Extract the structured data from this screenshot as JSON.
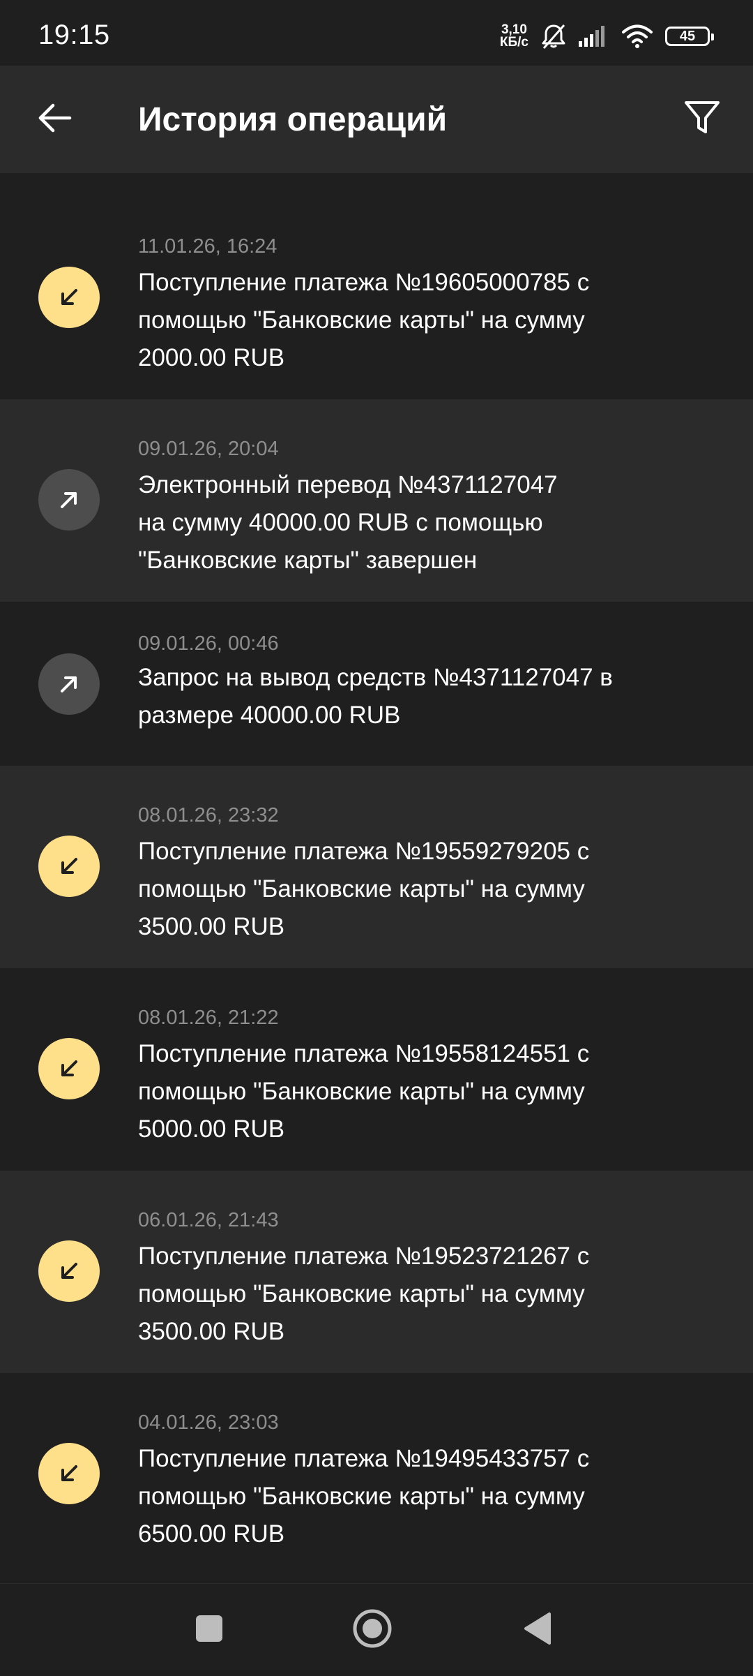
{
  "status_bar": {
    "time": "19:15",
    "net_speed_value": "3,10",
    "net_speed_unit": "КБ/с",
    "battery": "45",
    "icons": [
      "mute-bell-icon",
      "signal-icon",
      "wifi-icon",
      "battery-icon"
    ]
  },
  "app_bar": {
    "title": "История операций",
    "icons": [
      "arrow-left-icon",
      "filter-icon"
    ]
  },
  "colors": {
    "background": "#1f1f1f",
    "row_alt": "#2b2b2b",
    "incoming_icon_bg": "#ffe08a",
    "outgoing_icon_bg": "#4d4d4d",
    "date_text": "#8e8e8e"
  },
  "operations": [
    {
      "type": "incoming",
      "icon": "arrow-down-left-icon",
      "date": "11.01.26, 16:24",
      "text": "Поступление платежа №19605000785 с\nпомощью \"Банковские карты\" на сумму\n2000.00 RUB"
    },
    {
      "type": "outgoing",
      "icon": "arrow-up-right-icon",
      "date": "09.01.26, 20:04",
      "text": "Электронный перевод №4371127047\nна сумму 40000.00 RUB с помощью\n\"Банковские карты\" завершен"
    },
    {
      "type": "outgoing",
      "icon": "arrow-up-right-icon",
      "date": "09.01.26, 00:46",
      "text": "Запрос на вывод средств №4371127047 в\nразмере 40000.00 RUB"
    },
    {
      "type": "incoming",
      "icon": "arrow-down-left-icon",
      "date": "08.01.26, 23:32",
      "text": "Поступление платежа №19559279205 с\nпомощью \"Банковские карты\" на сумму\n3500.00 RUB"
    },
    {
      "type": "incoming",
      "icon": "arrow-down-left-icon",
      "date": "08.01.26, 21:22",
      "text": "Поступление платежа №19558124551 с\nпомощью \"Банковские карты\" на сумму\n5000.00 RUB"
    },
    {
      "type": "incoming",
      "icon": "arrow-down-left-icon",
      "date": "06.01.26, 21:43",
      "text": "Поступление платежа №19523721267 с\nпомощью \"Банковские карты\" на сумму\n3500.00 RUB"
    },
    {
      "type": "incoming",
      "icon": "arrow-down-left-icon",
      "date": "04.01.26, 23:03",
      "text": "Поступление платежа №19495433757 с\nпомощью \"Банковские карты\" на сумму\n6500.00 RUB"
    }
  ],
  "nav_bar": {
    "icons": [
      "square-recents-icon",
      "circle-home-icon",
      "triangle-back-icon"
    ]
  }
}
